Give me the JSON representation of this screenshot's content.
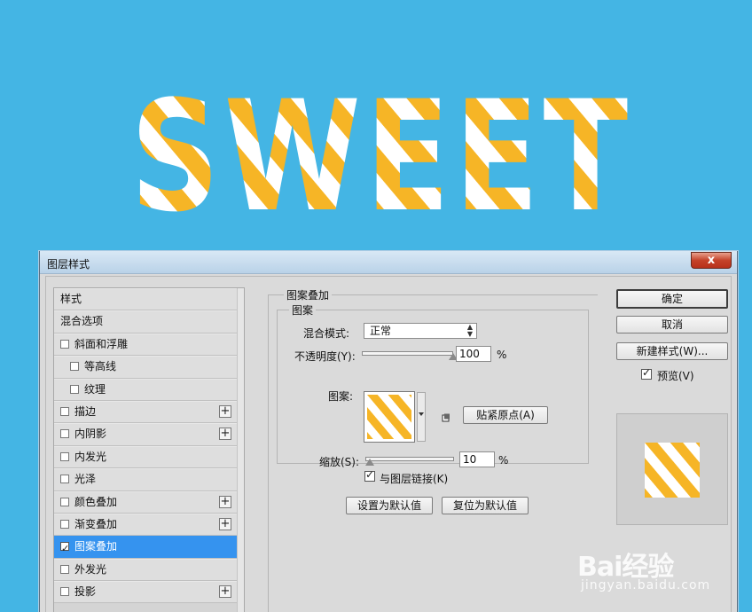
{
  "artwork": {
    "word": "SWEET",
    "stripe_color": "#f6b526",
    "fill_color": "#ffffff",
    "background": "#44b5e4"
  },
  "dialog": {
    "title": "图层样式",
    "close_label": "x",
    "styles_list": [
      {
        "label": "样式",
        "kind": "header"
      },
      {
        "label": "混合选项",
        "kind": "header"
      },
      {
        "label": "斜面和浮雕",
        "kind": "check",
        "checked": false,
        "plus": false
      },
      {
        "label": "等高线",
        "kind": "sub",
        "checked": false
      },
      {
        "label": "纹理",
        "kind": "sub",
        "checked": false
      },
      {
        "label": "描边",
        "kind": "check",
        "checked": false,
        "plus": true
      },
      {
        "label": "内阴影",
        "kind": "check",
        "checked": false,
        "plus": true
      },
      {
        "label": "内发光",
        "kind": "check",
        "checked": false,
        "plus": false
      },
      {
        "label": "光泽",
        "kind": "check",
        "checked": false,
        "plus": false
      },
      {
        "label": "颜色叠加",
        "kind": "check",
        "checked": false,
        "plus": true
      },
      {
        "label": "渐变叠加",
        "kind": "check",
        "checked": false,
        "plus": true
      },
      {
        "label": "图案叠加",
        "kind": "check",
        "checked": true,
        "plus": false,
        "active": true
      },
      {
        "label": "外发光",
        "kind": "check",
        "checked": false,
        "plus": false
      },
      {
        "label": "投影",
        "kind": "check",
        "checked": false,
        "plus": true
      }
    ],
    "pattern_overlay": {
      "section_title": "图案叠加",
      "group_title": "图案",
      "blend_mode_label": "混合模式:",
      "blend_mode_value": "正常",
      "opacity_label": "不透明度(Y):",
      "opacity_value": "100",
      "opacity_unit": "%",
      "opacity_fraction": 1.0,
      "pattern_label": "图案:",
      "snap_origin_label": "贴紧原点(A)",
      "scale_label": "缩放(S):",
      "scale_value": "10",
      "scale_unit": "%",
      "scale_fraction": 0.0,
      "link_label": "与图层链接(K)",
      "link_checked": true,
      "make_default_label": "设置为默认值",
      "reset_default_label": "复位为默认值"
    },
    "actions": {
      "ok_label": "确定",
      "cancel_label": "取消",
      "new_style_label": "新建样式(W)...",
      "preview_label": "预览(V)",
      "preview_checked": true
    }
  },
  "watermark": {
    "brand": "Bai经验",
    "sub": "jingyan.baidu.com"
  }
}
